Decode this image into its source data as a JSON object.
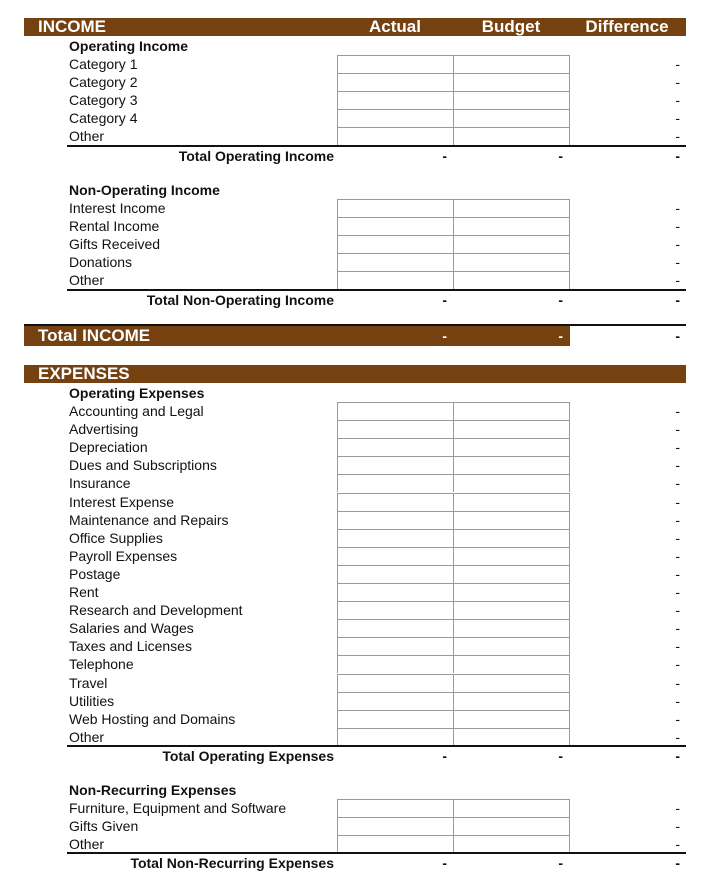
{
  "colors": {
    "header_bar": "#754110",
    "header_text": "#ffffff",
    "cell_border": "#9a9a9a"
  },
  "income": {
    "title": "INCOME",
    "columns": [
      "Actual",
      "Budget",
      "Difference"
    ],
    "operating": {
      "title": "Operating Income",
      "items": [
        {
          "label": "Category 1",
          "actual": "",
          "budget": "",
          "difference": "-"
        },
        {
          "label": "Category 2",
          "actual": "",
          "budget": "",
          "difference": "-"
        },
        {
          "label": "Category 3",
          "actual": "",
          "budget": "",
          "difference": "-"
        },
        {
          "label": "Category 4",
          "actual": "",
          "budget": "",
          "difference": "-"
        },
        {
          "label": "Other",
          "actual": "",
          "budget": "",
          "difference": "-"
        }
      ],
      "total": {
        "label": "Total Operating Income",
        "actual": "-",
        "budget": "-",
        "difference": "-"
      }
    },
    "non_operating": {
      "title": "Non-Operating Income",
      "items": [
        {
          "label": "Interest Income",
          "actual": "",
          "budget": "",
          "difference": "-"
        },
        {
          "label": "Rental Income",
          "actual": "",
          "budget": "",
          "difference": "-"
        },
        {
          "label": "Gifts Received",
          "actual": "",
          "budget": "",
          "difference": "-"
        },
        {
          "label": "Donations",
          "actual": "",
          "budget": "",
          "difference": "-"
        },
        {
          "label": "Other",
          "actual": "",
          "budget": "",
          "difference": "-"
        }
      ],
      "total": {
        "label": "Total Non-Operating Income",
        "actual": "-",
        "budget": "-",
        "difference": "-"
      }
    },
    "grand_total": {
      "label": "Total INCOME",
      "actual": "-",
      "budget": "-",
      "difference": "-"
    }
  },
  "expenses": {
    "title": "EXPENSES",
    "operating": {
      "title": "Operating Expenses",
      "items": [
        {
          "label": "Accounting and Legal",
          "actual": "",
          "budget": "",
          "difference": "-"
        },
        {
          "label": "Advertising",
          "actual": "",
          "budget": "",
          "difference": "-"
        },
        {
          "label": "Depreciation",
          "actual": "",
          "budget": "",
          "difference": "-"
        },
        {
          "label": "Dues and Subscriptions",
          "actual": "",
          "budget": "",
          "difference": "-"
        },
        {
          "label": "Insurance",
          "actual": "",
          "budget": "",
          "difference": "-"
        },
        {
          "label": "Interest Expense",
          "actual": "",
          "budget": "",
          "difference": "-"
        },
        {
          "label": "Maintenance and Repairs",
          "actual": "",
          "budget": "",
          "difference": "-"
        },
        {
          "label": "Office Supplies",
          "actual": "",
          "budget": "",
          "difference": "-"
        },
        {
          "label": "Payroll Expenses",
          "actual": "",
          "budget": "",
          "difference": "-"
        },
        {
          "label": "Postage",
          "actual": "",
          "budget": "",
          "difference": "-"
        },
        {
          "label": "Rent",
          "actual": "",
          "budget": "",
          "difference": "-"
        },
        {
          "label": "Research and Development",
          "actual": "",
          "budget": "",
          "difference": "-"
        },
        {
          "label": "Salaries and Wages",
          "actual": "",
          "budget": "",
          "difference": "-"
        },
        {
          "label": "Taxes and Licenses",
          "actual": "",
          "budget": "",
          "difference": "-"
        },
        {
          "label": "Telephone",
          "actual": "",
          "budget": "",
          "difference": "-"
        },
        {
          "label": "Travel",
          "actual": "",
          "budget": "",
          "difference": "-"
        },
        {
          "label": "Utilities",
          "actual": "",
          "budget": "",
          "difference": "-"
        },
        {
          "label": "Web Hosting and Domains",
          "actual": "",
          "budget": "",
          "difference": "-"
        },
        {
          "label": "Other",
          "actual": "",
          "budget": "",
          "difference": "-"
        }
      ],
      "total": {
        "label": "Total Operating Expenses",
        "actual": "-",
        "budget": "-",
        "difference": "-"
      }
    },
    "non_recurring": {
      "title": "Non-Recurring Expenses",
      "items": [
        {
          "label": "Furniture, Equipment and Software",
          "actual": "",
          "budget": "",
          "difference": "-"
        },
        {
          "label": "Gifts Given",
          "actual": "",
          "budget": "",
          "difference": "-"
        },
        {
          "label": "Other",
          "actual": "",
          "budget": "",
          "difference": "-"
        }
      ],
      "total": {
        "label": "Total Non-Recurring Expenses",
        "actual": "-",
        "budget": "-",
        "difference": "-"
      }
    }
  }
}
